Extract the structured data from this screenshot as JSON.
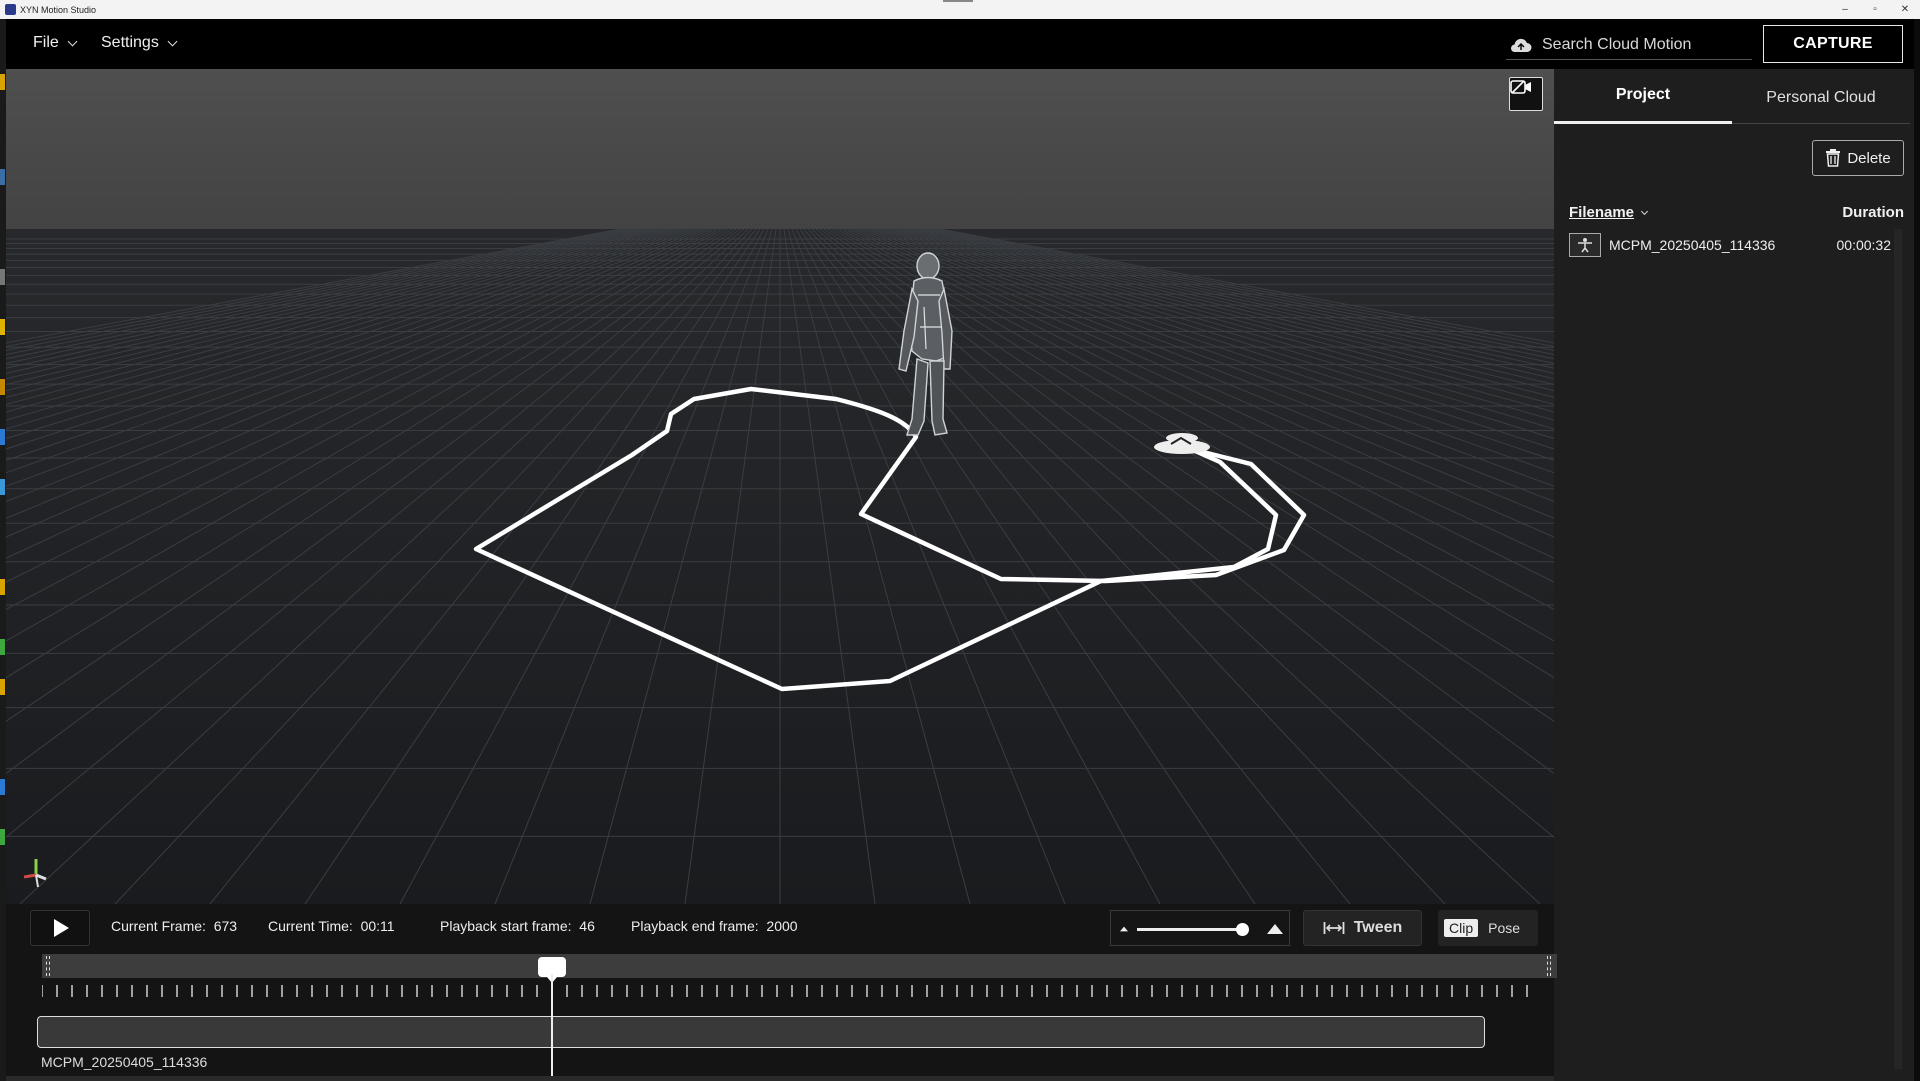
{
  "window": {
    "title": "XYN Motion Studio",
    "controls": [
      "–",
      "▫",
      "✕"
    ]
  },
  "menu": {
    "file": "File",
    "settings": "Settings"
  },
  "search": {
    "placeholder": "Search Cloud Motion"
  },
  "capture": {
    "label": "CAPTURE"
  },
  "panel": {
    "tabs": [
      {
        "label": "Project",
        "active": true
      },
      {
        "label": "Personal Cloud",
        "active": false
      }
    ],
    "delete_label": "Delete",
    "columns": {
      "filename": "Filename",
      "duration": "Duration"
    },
    "files": [
      {
        "name": "MCPM_20250405_114336",
        "duration": "00:00:32"
      }
    ]
  },
  "playback": {
    "current_frame_label": "Current Frame:",
    "current_frame": "673",
    "current_time_label": "Current Time:",
    "current_time": "00:11",
    "start_label": "Playback start frame:",
    "start_frame": "46",
    "end_label": "Playback end frame:",
    "end_frame": "2000",
    "zoom_level": 0.95,
    "tween_label": "Tween",
    "clip_label": "Clip",
    "pose_label": "Pose"
  },
  "timeline": {
    "clip_name": "MCPM_20250405_114336",
    "playhead_fraction": 0.3365
  },
  "colors": {
    "background": "#000000",
    "viewport_ground": "#1c1e21",
    "viewport_sky": "#4a4a4a",
    "panel": "#1e1e1e",
    "accent": "#ffffff"
  },
  "icons": {
    "cloud": "cloud-icon",
    "camera": "camera-icon",
    "trash": "trash-icon",
    "play": "play-icon",
    "tween": "tween-icon",
    "figure": "figure-icon"
  }
}
